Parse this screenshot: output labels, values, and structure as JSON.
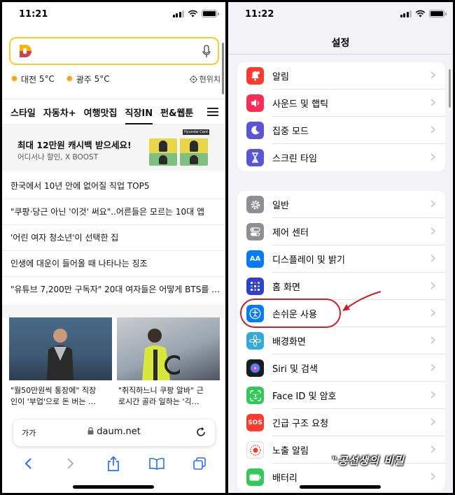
{
  "left": {
    "status": {
      "time": "11:21"
    },
    "weather": [
      {
        "city": "대전",
        "temp": "5°C"
      },
      {
        "city": "광주",
        "temp": "5°C"
      }
    ],
    "location_label": "현위치",
    "tabs": [
      "스타일",
      "자동차+",
      "여행맛집",
      "직장IN",
      "펀&웹툰"
    ],
    "active_tab": "직장IN",
    "ad": {
      "title": "최대 12만원 캐시백 받으세요!",
      "sub": "어디서나 할인, X BOOST",
      "card_brand": "Hyundai Card"
    },
    "news": [
      "한국에서 10년 안에 없어질 직업 TOP5",
      "\"쿠팡·당근 아닌 '이것' 써요\"..어른들은 모르는 10대 앱",
      "'어린 여자 청소년'이 선택한 집",
      "인생에 대운이 들어올 때 나타나는 징조",
      "\"유튜브 7,200만 구독자\" 20대 여자들은 어떻게 BTS를 …"
    ],
    "cards": [
      {
        "line1": "\"월50만원씩 통장에\" 직장",
        "line2": "인이 '부업'으로 돈 버는 …"
      },
      {
        "line1": "\"취직하느니 쿠팡 알바\" 근",
        "line2": "로시간 골라 일하는 '긱…"
      }
    ],
    "address": {
      "text_size": "가가",
      "url": "daum.net"
    }
  },
  "right": {
    "status": {
      "time": "11:22"
    },
    "title": "설정",
    "groups": [
      [
        {
          "label": "알림",
          "color": "#ff3b30",
          "icon": "bell-icon"
        },
        {
          "label": "사운드 및 햅틱",
          "color": "#ff2d55",
          "icon": "speaker-icon"
        },
        {
          "label": "집중 모드",
          "color": "#5856d6",
          "icon": "moon-icon"
        },
        {
          "label": "스크린 타임",
          "color": "#5856d6",
          "icon": "hourglass-icon"
        }
      ],
      [
        {
          "label": "일반",
          "color": "#8e8e93",
          "icon": "gear-icon"
        },
        {
          "label": "제어 센터",
          "color": "#8e8e93",
          "icon": "toggles-icon"
        },
        {
          "label": "디스플레이 및 밝기",
          "color": "#007aff",
          "icon": "text-size-icon"
        },
        {
          "label": "홈 화면",
          "color": "#2f3fd0",
          "icon": "home-grid-icon"
        },
        {
          "label": "손쉬운 사용",
          "color": "#007aff",
          "icon": "accessibility-icon"
        },
        {
          "label": "배경화면",
          "color": "#34aadc",
          "icon": "flower-icon"
        },
        {
          "label": "Siri 및 검색",
          "color": "#1c1c1e",
          "icon": "siri-icon"
        },
        {
          "label": "Face ID 및 암호",
          "color": "#34c759",
          "icon": "face-id-icon"
        },
        {
          "label": "긴급 구조 요청",
          "color": "#ff3b30",
          "icon": "sos-icon"
        },
        {
          "label": "노출 알림",
          "color": "#ffffff",
          "icon": "exposure-icon"
        },
        {
          "label": "배터리",
          "color": "#34c759",
          "icon": "battery-icon"
        }
      ]
    ],
    "watermark": "\"공선생의 비밀"
  }
}
